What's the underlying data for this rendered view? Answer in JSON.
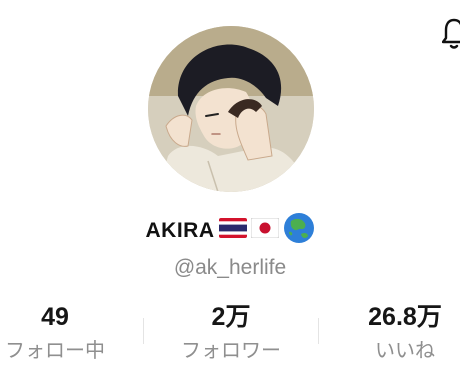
{
  "profile": {
    "display_name": "AKIRA",
    "name_emojis": [
      "thailand-flag-icon",
      "japan-flag-icon",
      "globe-asia-icon"
    ],
    "handle": "@ak_herlife"
  },
  "stats": [
    {
      "value": "49",
      "label": "フォロー中"
    },
    {
      "value": "2万",
      "label": "フォロワー"
    },
    {
      "value": "26.8万",
      "label": "いいね"
    }
  ],
  "colors": {
    "primary_text": "#111111",
    "secondary_text": "#8a8a8a",
    "divider": "#e4e4e4"
  }
}
